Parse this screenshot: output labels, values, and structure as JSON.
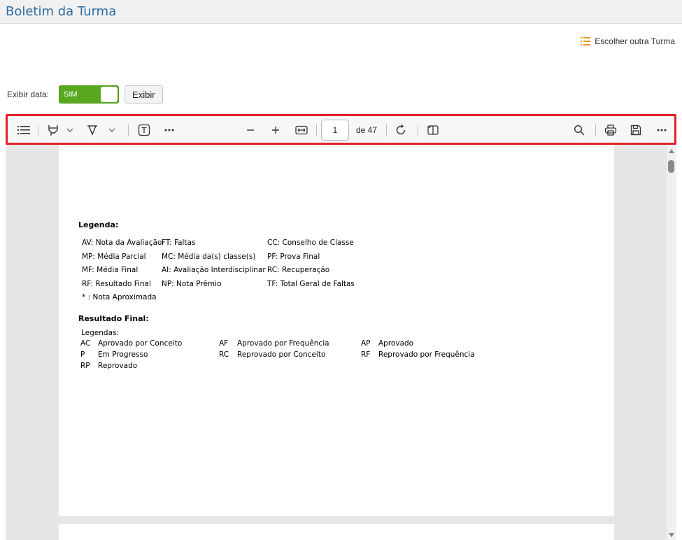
{
  "header": {
    "title": "Boletim da Turma"
  },
  "choose_link": {
    "label": "Escolher outra Turma",
    "icon": "list-icon",
    "icon_color": "#e39a1f"
  },
  "date_filter": {
    "label": "Exibir data:",
    "toggle_label": "SIM",
    "toggle_on": true,
    "toggle_color": "#57a81f",
    "button": "Exibir"
  },
  "toolbar": {
    "icons": [
      "contents-icon",
      "highlight-icon",
      "chevron-down-icon",
      "draw-icon",
      "chevron-down-icon",
      "text-box-icon",
      "more-icon",
      "zoom-out-icon",
      "zoom-in-icon",
      "fit-width-icon",
      "rotate-icon",
      "page-view-icon",
      "search-icon",
      "print-icon",
      "save-icon",
      "more-icon"
    ],
    "page_current": "1",
    "page_total_label": "de 47"
  },
  "document": {
    "legend_title": "Legenda:",
    "legend_rows": [
      [
        "AV: Nota da Avaliação",
        "FT: Faltas",
        "CC: Conselho de Classe"
      ],
      [
        "MP: Média Parcial",
        "MC: Média da(s) classe(s)",
        "PF: Prova Final"
      ],
      [
        "MF: Média Final",
        "AI: Avaliação Interdisciplinar",
        "RC: Recuperação"
      ],
      [
        "RF: Resultado Final",
        "NP: Nota Prêmio",
        "TF: Total Geral de Faltas"
      ],
      [
        "* : Nota Aproximada",
        "",
        ""
      ]
    ],
    "result_title": "Resultado Final:",
    "result_subtitle": "Legendas:",
    "result_rows": [
      [
        {
          "code": "AC",
          "desc": "Aprovado por Conceito"
        },
        {
          "code": "AF",
          "desc": "Aprovado por Frequência"
        },
        {
          "code": "AP",
          "desc": "Aprovado"
        }
      ],
      [
        {
          "code": "P",
          "desc": "Em Progresso"
        },
        {
          "code": "RC",
          "desc": "Reprovado por Conceito"
        },
        {
          "code": "RF",
          "desc": "Reprovado por Frequência"
        }
      ],
      [
        {
          "code": "RP",
          "desc": "Reprovado"
        },
        {
          "code": "",
          "desc": ""
        },
        {
          "code": "",
          "desc": ""
        }
      ]
    ]
  },
  "colors": {
    "title": "#2f6ea5",
    "toolbar_highlight": "#e3202a"
  }
}
